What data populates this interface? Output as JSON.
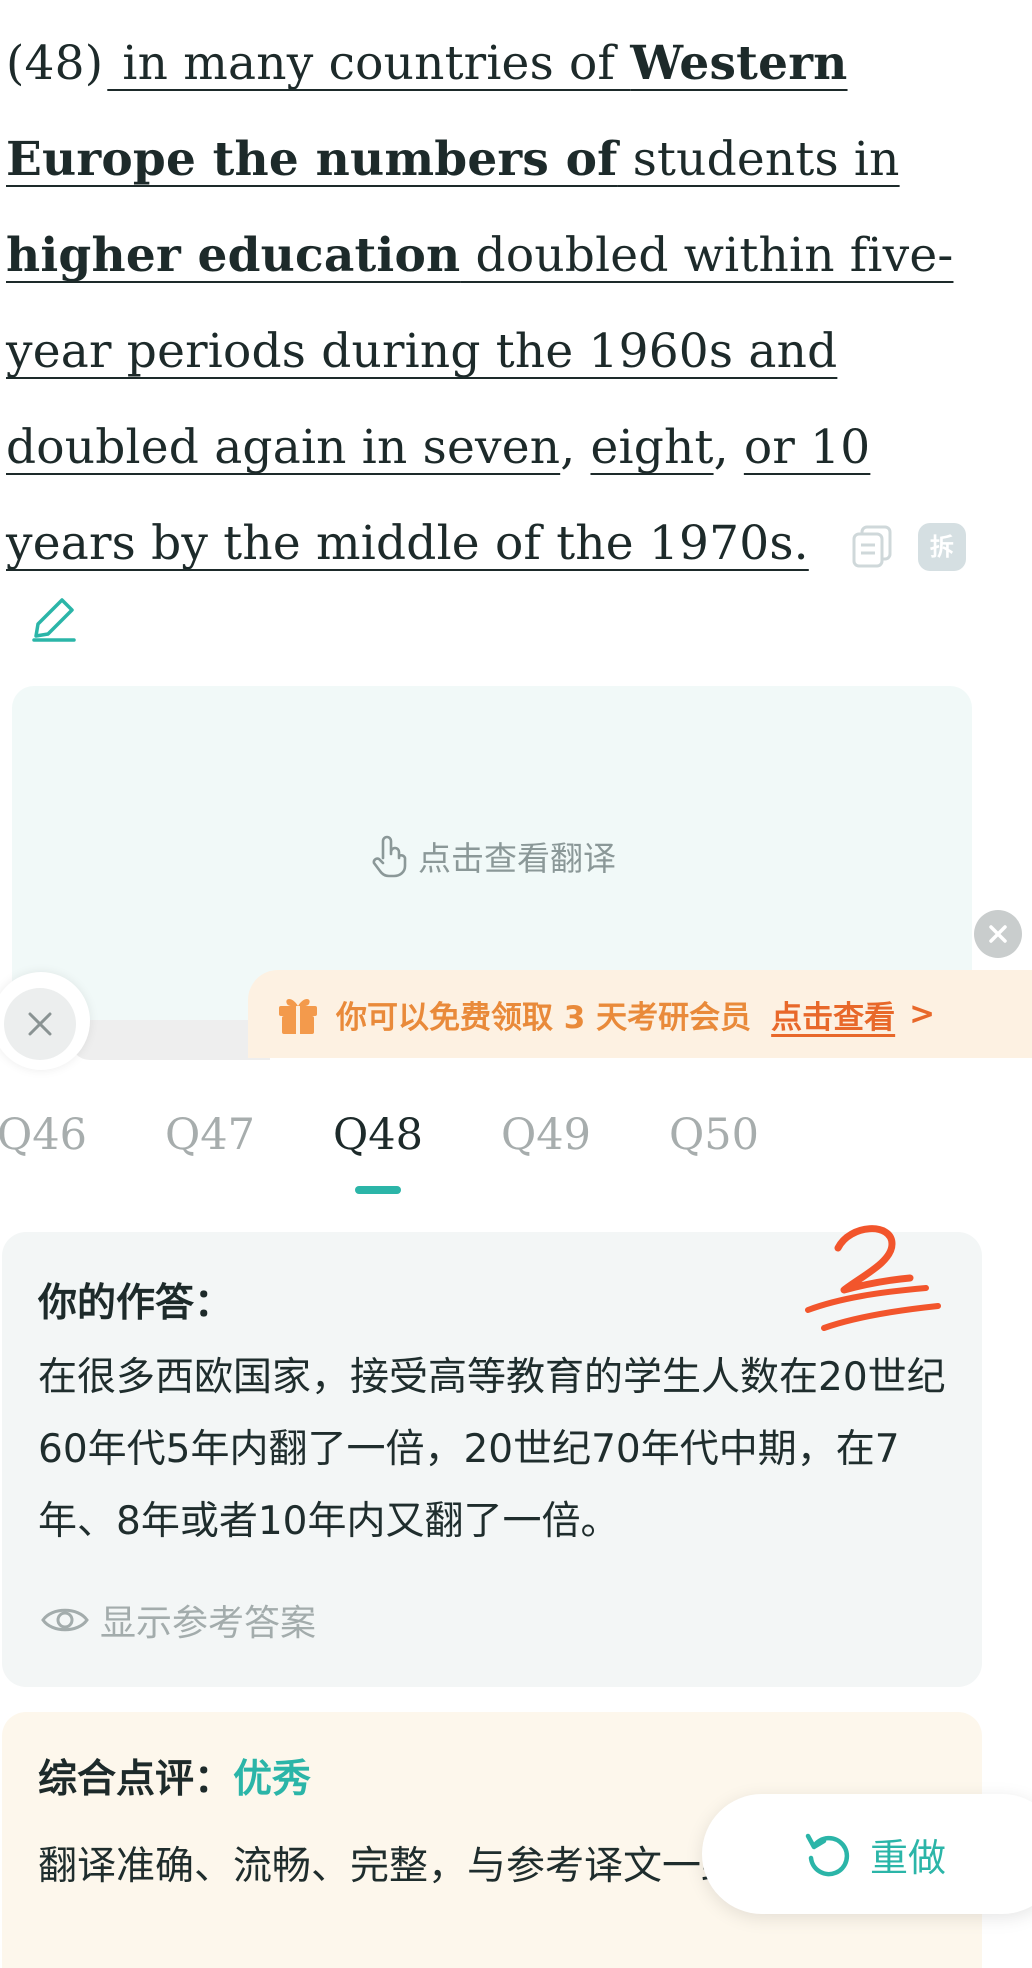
{
  "passage": {
    "number": "(48)",
    "segments": [
      {
        "text": " in many countries of ",
        "bold": false
      },
      {
        "text": "Western Europe the numbers of",
        "bold": true
      },
      {
        "text": " students in ",
        "bold": false
      },
      {
        "text": "higher education",
        "bold": true
      },
      {
        "text": " doubled within five-year periods during the 1960s and doubled again in seven",
        "bold": false
      },
      {
        "text": ", ",
        "bold": false
      },
      {
        "text": "eight",
        "bold": false
      },
      {
        "text": ", ",
        "bold": false
      },
      {
        "text": "or 10 years by the middle of the 1970s.",
        "bold": false
      }
    ],
    "split_icon_label": "拆"
  },
  "translation_card": {
    "hint": "点击查看翻译"
  },
  "promo": {
    "text": "你可以免费领取 3 天考研会员",
    "link": "点击查看",
    "arrow": ">"
  },
  "tabs": [
    {
      "label": "Q46",
      "active": false
    },
    {
      "label": "Q47",
      "active": false
    },
    {
      "label": "Q48",
      "active": true
    },
    {
      "label": "Q49",
      "active": false
    },
    {
      "label": "Q50",
      "active": false
    }
  ],
  "answer": {
    "title": "你的作答：",
    "text": "在很多西欧国家，接受高等教育的学生人数在20世纪60年代5年内翻了一倍，20世纪70年代中期，在7年、8年或者10年内又翻了一倍。",
    "show_reference": "显示参考答案"
  },
  "review": {
    "title": "综合点评：",
    "grade": "优秀",
    "text": "翻译准确、流畅、完整，与参考译文一致。"
  },
  "redo": {
    "label": "重做"
  },
  "colors": {
    "accent": "#2bb5a8",
    "promo_text": "#e98a3a",
    "promo_link": "#e8682a",
    "handwritten_mark": "#f2552c"
  }
}
